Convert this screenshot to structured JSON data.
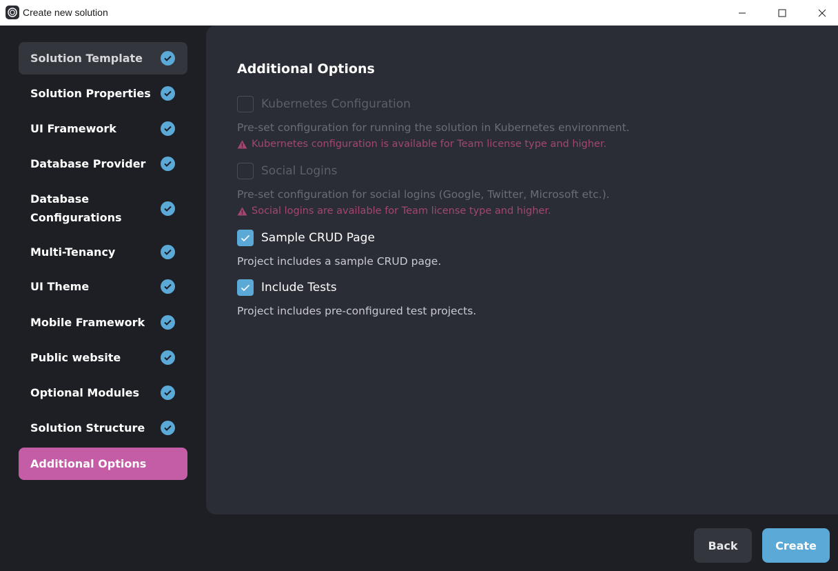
{
  "window": {
    "title": "Create new solution"
  },
  "sidebar": {
    "items": [
      {
        "label": "Solution Template",
        "state": "visited"
      },
      {
        "label": "Solution Properties",
        "state": "done"
      },
      {
        "label": "UI Framework",
        "state": "done"
      },
      {
        "label": "Database Provider",
        "state": "done"
      },
      {
        "label": "Database Configurations",
        "state": "done"
      },
      {
        "label": "Multi-Tenancy",
        "state": "done"
      },
      {
        "label": "UI Theme",
        "state": "done"
      },
      {
        "label": "Mobile Framework",
        "state": "done"
      },
      {
        "label": "Public website",
        "state": "done"
      },
      {
        "label": "Optional Modules",
        "state": "done"
      },
      {
        "label": "Solution Structure",
        "state": "done"
      },
      {
        "label": "Additional Options",
        "state": "active"
      }
    ],
    "check_icon": "check-circle-icon"
  },
  "main": {
    "title": "Additional Options",
    "options": [
      {
        "label": "Kubernetes Configuration",
        "checked": false,
        "disabled": true,
        "description": "Pre-set configuration for running the solution in Kubernetes environment.",
        "warning": "Kubernetes configuration is available for Team license type and higher."
      },
      {
        "label": "Social Logins",
        "checked": false,
        "disabled": true,
        "description": "Pre-set configuration for social logins (Google, Twitter, Microsoft etc.).",
        "warning": "Social logins are available for Team license type and higher."
      },
      {
        "label": "Sample CRUD Page",
        "checked": true,
        "disabled": false,
        "description": "Project includes a sample CRUD page."
      },
      {
        "label": "Include Tests",
        "checked": true,
        "disabled": false,
        "description": "Project includes pre-configured test projects."
      }
    ]
  },
  "footer": {
    "back_label": "Back",
    "create_label": "Create"
  },
  "colors": {
    "accent_active": "#c45ca6",
    "accent_primary": "#5aa9d6",
    "warning": "#a3476f",
    "panel_bg": "#2a2d35",
    "app_bg": "#1d1f25"
  }
}
